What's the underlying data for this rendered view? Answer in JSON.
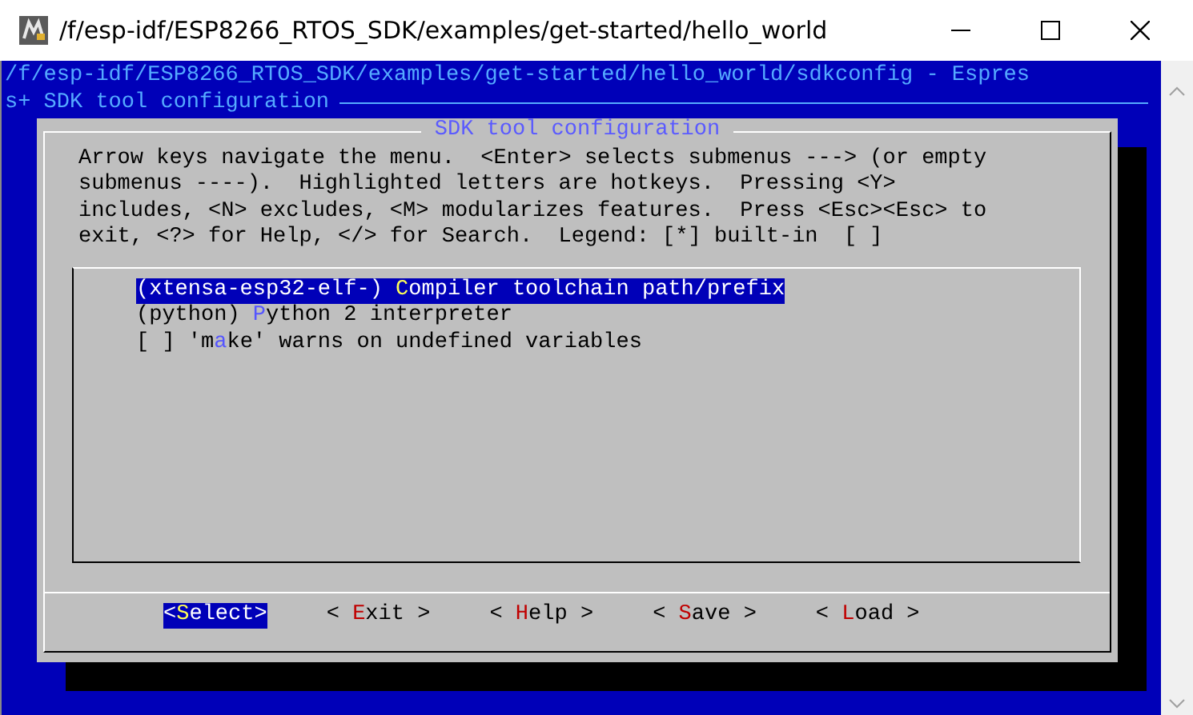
{
  "window": {
    "title": "/f/esp-idf/ESP8266_RTOS_SDK/examples/get-started/hello_world"
  },
  "terminal": {
    "header_lines": [
      "/f/esp-idf/ESP8266_RTOS_SDK/examples/get-started/hello_world/sdkconfig - Espres",
      "s+ SDK tool configuration"
    ]
  },
  "dialog": {
    "title": "SDK tool configuration",
    "help_lines": [
      "Arrow keys navigate the menu.  <Enter> selects submenus ---> (or empty",
      "submenus ----).  Highlighted letters are hotkeys.  Pressing <Y>",
      "includes, <N> excludes, <M> modularizes features.  Press <Esc><Esc> to",
      "exit, <?> for Help, </> for Search.  Legend: [*] built-in  [ ]"
    ],
    "menu_items": [
      {
        "before": "(xtensa-esp32-elf-) ",
        "hotkey": "C",
        "after": "ompiler toolchain path/prefix",
        "selected": true
      },
      {
        "before": "(python) ",
        "hotkey": "P",
        "after": "ython 2 interpreter",
        "selected": false
      },
      {
        "before": "[ ] 'm",
        "hotkey": "a",
        "after": "ke' warns on undefined variables",
        "selected": false
      }
    ],
    "buttons": [
      {
        "open": "<",
        "hotkey": "S",
        "rest": "elect",
        "close": ">",
        "selected": true
      },
      {
        "open": "<",
        "hotkey": "E",
        "rest": "xit",
        "close": ">",
        "selected": false
      },
      {
        "open": "<",
        "hotkey": "H",
        "rest": "elp",
        "close": ">",
        "selected": false
      },
      {
        "open": "<",
        "hotkey": "S",
        "rest": "ave",
        "close": ">",
        "selected": false
      },
      {
        "open": "<",
        "hotkey": "L",
        "rest": "oad",
        "close": ">",
        "selected": false
      }
    ]
  }
}
